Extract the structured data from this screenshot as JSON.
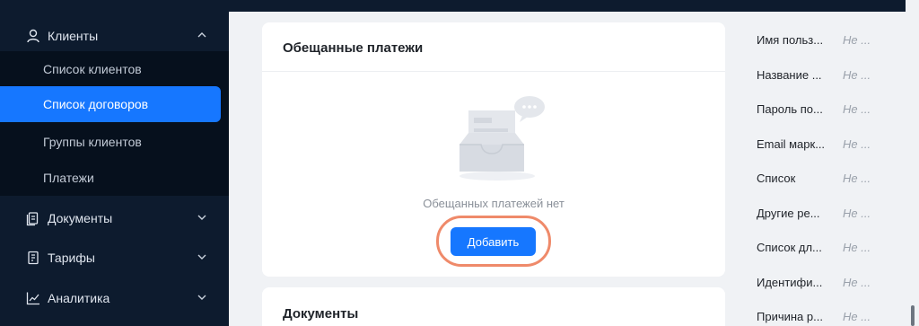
{
  "sidebar": {
    "clients_label": "Клиенты",
    "sub_items": [
      {
        "label": "Список клиентов"
      },
      {
        "label": "Список договоров"
      },
      {
        "label": "Группы клиентов"
      },
      {
        "label": "Платежи"
      }
    ],
    "documents_label": "Документы",
    "tariffs_label": "Тарифы",
    "analytics_label": "Аналитика",
    "active_color": "#1677ff",
    "bg_color": "#0d1b2e"
  },
  "promised_payments": {
    "title": "Обещанные платежи",
    "empty_text": "Обещанных платежей нет",
    "add_button": "Добавить"
  },
  "documents": {
    "title": "Документы"
  },
  "fields": [
    {
      "key": "Имя польз...",
      "value": "Не ..."
    },
    {
      "key": "Название ...",
      "value": "Не ..."
    },
    {
      "key": "Пароль по...",
      "value": "Не ..."
    },
    {
      "key": "Email марк...",
      "value": "Не ..."
    },
    {
      "key": "Список",
      "value": "Не ..."
    },
    {
      "key": "Другие ре...",
      "value": "Не ..."
    },
    {
      "key": "Список дл...",
      "value": "Не ..."
    },
    {
      "key": "Идентифи...",
      "value": "Не ..."
    },
    {
      "key": "Причина р...",
      "value": "Не ..."
    }
  ]
}
